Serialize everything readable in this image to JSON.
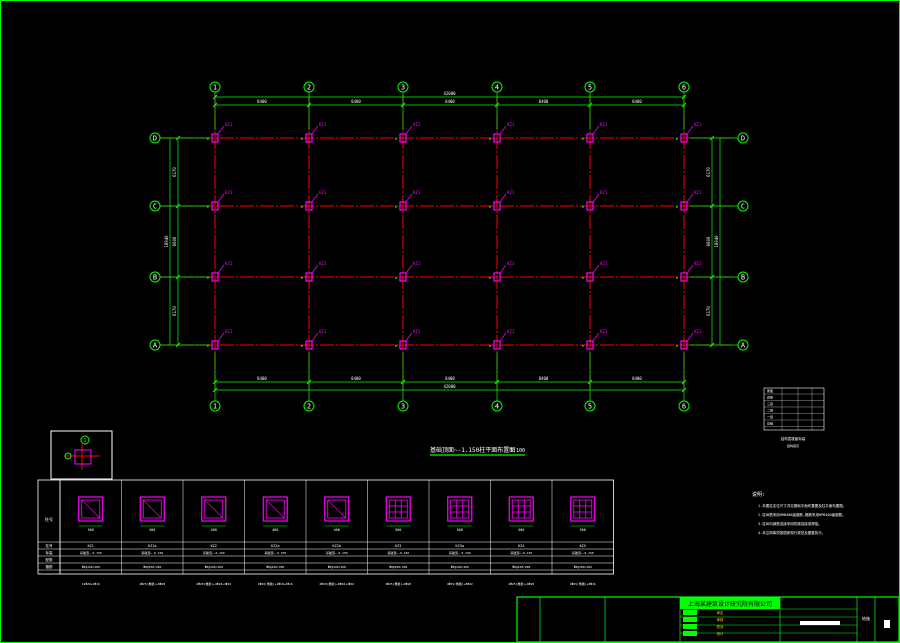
{
  "drawing": {
    "grid_columns": [
      "1",
      "2",
      "3",
      "4",
      "5",
      "6"
    ],
    "grid_rows": [
      "D",
      "C",
      "B",
      "A"
    ],
    "dims_top": [
      "8400",
      "8400",
      "8400",
      "8400",
      "8400"
    ],
    "dim_total_top": "42000",
    "dims_bottom": [
      "8400",
      "8400",
      "8400",
      "8400",
      "8400"
    ],
    "dim_total_bottom": "42000",
    "dims_left": [
      "6170",
      "6600",
      "6170"
    ],
    "dim_total_left": "18940",
    "dims_right": [
      "6170",
      "6600",
      "6170"
    ],
    "dim_total_right": "18940",
    "column_tag": "KZ1",
    "section_title": "基础顶面~-1.150柱平面布置图",
    "section_scale": "1:100",
    "legend_label": "柱号",
    "legend_marker": "1"
  },
  "schedule": {
    "row_header": "柱号",
    "row_labels": [
      "柱号",
      "标高",
      "配筋",
      "箍筋"
    ],
    "columns": [
      {
        "name": "KZ1",
        "size": "500",
        "elev": "基础顶~-0.150",
        "stirrup": "Φ8@100/200",
        "note": "12Φ20+4Φ16"
      },
      {
        "name": "KZ1a",
        "size": "500",
        "elev": "基础顶~-0.150",
        "stirrup": "Φ8@100/200",
        "note": "4Φ25(角筋)+8Φ20"
      },
      {
        "name": "KZ2",
        "size": "400",
        "elev": "基础顶~-0.150",
        "stirrup": "Φ8@100/200",
        "note": "4Φ20(角筋)+4Φ18+4Φ16"
      },
      {
        "name": "KZ2a",
        "size": "400",
        "elev": "基础顶~-0.150",
        "stirrup": "Φ8@100/200",
        "note": "4Φ20(角筋)+4Φ18+4Φ16"
      },
      {
        "name": "KZ2b",
        "size": "400",
        "elev": "基础顶~-0.150",
        "stirrup": "Φ8@100/200",
        "note": "4Φ20(角筋)+8Φ20+4Φ16"
      },
      {
        "name": "KZ3",
        "size": "500",
        "elev": "基础顶~-0.150",
        "stirrup": "Φ8@100/200",
        "note": "4Φ25(角筋)+8Φ20"
      },
      {
        "name": "KZ3a",
        "size": "500",
        "elev": "基础顶~-0.150",
        "stirrup": "Φ8@100/200",
        "note": "4Φ25(角筋)+8Φ22"
      },
      {
        "name": "KZ4",
        "size": "500",
        "elev": "基础顶~-0.150",
        "stirrup": "Φ8@100/200",
        "note": "4Φ25(角筋)+8Φ20"
      },
      {
        "name": "KZ5",
        "size": "500",
        "elev": "基础顶~-0.150",
        "stirrup": "Φ8@100/200",
        "note": "4Φ25(角筋)+8Φ16"
      }
    ]
  },
  "notes": {
    "heading": "说明:",
    "items": [
      "1.本图柱定位尺寸详见基础平面布置图及柱平面布置图。",
      "2.柱纵筋采用HRB400级钢筋,箍筋采用HPB300级钢筋。",
      "3.柱纵向钢筋连接采用机械连接或焊接。",
      "4.未注明事项按国家现行规范及图集执行。"
    ]
  },
  "small_table": {
    "rows": [
      [
        "屋面",
        "",
        "",
        ""
      ],
      [
        "四层",
        "",
        "",
        ""
      ],
      [
        "三层",
        "",
        "",
        ""
      ],
      [
        "二层",
        "",
        "",
        ""
      ],
      [
        "一层",
        "",
        "",
        ""
      ],
      [
        "基础",
        "",
        "",
        ""
      ]
    ],
    "caption1": "结构层楼面标高",
    "caption2": "结构层高"
  },
  "title_block": {
    "company": "上海某建筑设计研究院有限公司",
    "sheet_no": "结施",
    "labels": [
      "审定",
      "审核",
      "校对",
      "设计",
      "制图"
    ]
  },
  "colors": {
    "grid": "#00ff00",
    "beam": "#ff0000",
    "column": "#ff00ff",
    "text": "#ffffff",
    "dim": "#00ff00"
  }
}
